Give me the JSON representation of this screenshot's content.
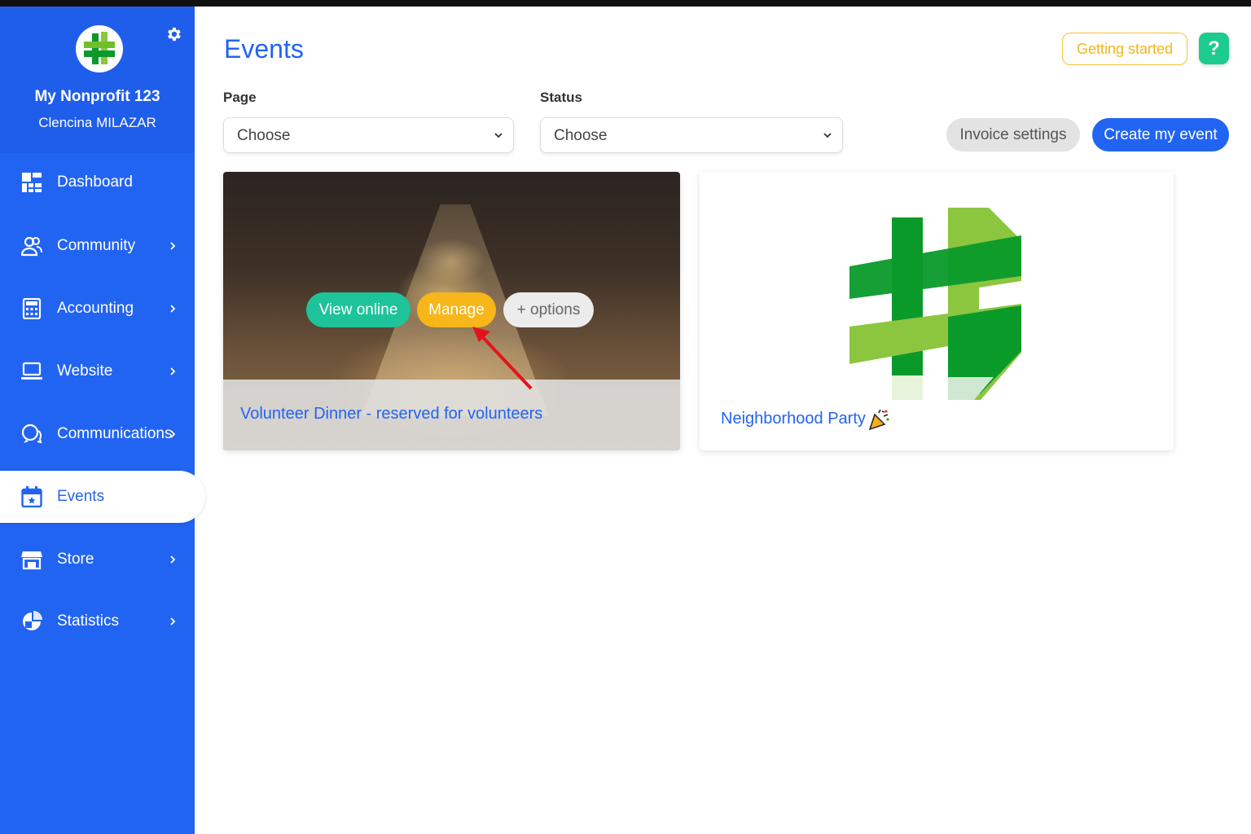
{
  "sidebar": {
    "org_name": "My Nonprofit 123",
    "user_name": "Clencina MILAZAR",
    "items": [
      {
        "label": "Dashboard",
        "icon": "dashboard-icon"
      },
      {
        "label": "Community",
        "icon": "community-icon"
      },
      {
        "label": "Accounting",
        "icon": "calculator-icon"
      },
      {
        "label": "Website",
        "icon": "laptop-icon"
      },
      {
        "label": "Communications",
        "icon": "chat-icon"
      },
      {
        "label": "Events",
        "icon": "calendar-icon",
        "active": true
      },
      {
        "label": "Store",
        "icon": "store-icon"
      },
      {
        "label": "Statistics",
        "icon": "pie-chart-icon"
      }
    ]
  },
  "header": {
    "title": "Events",
    "getting_started": "Getting started",
    "help": "?"
  },
  "filters": {
    "page_label": "Page",
    "page_value": "Choose",
    "status_label": "Status",
    "status_value": "Choose"
  },
  "actions": {
    "invoice_settings": "Invoice settings",
    "create_event": "Create my event"
  },
  "events": [
    {
      "title": "Volunteer Dinner - reserved for volunteers",
      "buttons": {
        "view": "View online",
        "manage": "Manage",
        "options": "+ options"
      }
    },
    {
      "title": "Neighborhood Party"
    }
  ],
  "colors": {
    "brand_blue": "#2264f2",
    "green": "#1ec39a",
    "yellow": "#f7b619"
  }
}
